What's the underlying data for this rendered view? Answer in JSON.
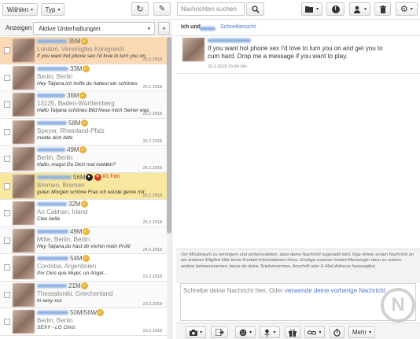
{
  "toolbar": {
    "select_label": "Wählen",
    "type_label": "Typ",
    "search_placeholder": "Nachrichten suchen"
  },
  "icons": {
    "refresh": "↻",
    "edit": "✎",
    "search": "🔍",
    "folder": "▰",
    "alert": "!",
    "user_action": "⚲",
    "trash": "🗑",
    "settings": "⚙",
    "caret": "▾"
  },
  "left": {
    "show_label": "Anzeigen",
    "filter_value": "Aktive Unterhaltungen"
  },
  "conversations": [
    {
      "age": "35M",
      "location": "London, Vereinigtes Königreich",
      "message": "If you want hot phone sex I'd love to turn you on",
      "date": "26.2.2018",
      "style": "orange"
    },
    {
      "age": "33M",
      "location": "Berlin, Berlin",
      "message": "Hey Tatjana,ich hoffe du hattest ein schönes",
      "date": "26.2.2018",
      "style": "normal"
    },
    {
      "age": "36M",
      "location": "13125, Baden-Württemberg",
      "message": "Hallo Tatjana schönes Bild freue mich Seiner was",
      "date": "26.2.2018",
      "style": "alt"
    },
    {
      "age": "58M",
      "location": "Speyer, Rheinland-Pfalz",
      "message": "melde dich bitte",
      "date": "26.2.2018",
      "style": "normal"
    },
    {
      "age": "49M",
      "location": "Berlin, Berlin",
      "message": "Hallo, magst Du Dich mal melden?",
      "date": "26.2.2018",
      "style": "alt"
    },
    {
      "age": "56M",
      "location": "Bremen, Bremen",
      "message": "guten Morgen schöne Frau ich würde gerne mit",
      "date": "26.2.2018",
      "style": "yellow",
      "fan": "#1 Fan"
    },
    {
      "age": "32M",
      "location": "An Cabhan, Irland",
      "message": "Ciao bella",
      "date": "25.2.2018",
      "style": "normal"
    },
    {
      "age": "49M",
      "location": "Mitte, Berlin, Berlin",
      "message": "Hey Tatjana,du hast dir vorhin mein Profil",
      "date": "24.2.2018",
      "style": "alt"
    },
    {
      "age": "54M",
      "location": "Cordoba, Argentinien",
      "message": "Por Dios que Mujer, un Angel...",
      "date": "23.2.2018",
      "style": "normal"
    },
    {
      "age": "21M",
      "location": "Thessaloniki, Griechenland",
      "message": "hi sexy xxx",
      "date": "23.2.2018",
      "style": "alt"
    },
    {
      "age": "50M/56W",
      "location": "Berlin, Berlin",
      "message": "SEXY - LG Chris",
      "date": "23.2.2018",
      "style": "normal"
    }
  ],
  "conversation": {
    "title_prefix": "Ich und",
    "quick_view": "Schnellansicht",
    "message": "If you want hot phone sex I'd love to turn you on and get you to cum hard. Drop me a message if you want to play.",
    "message_date": "26.2.2018 15:04 Uhr"
  },
  "notice": "Um Missbrauch zu verringern und sicherzustellen, dass deine Nachricht zugestellt wird, füge deiner ersten Nachricht an ein anderes Mitglied bitte keine Kontakt-Informationen hinzu. Erwäge unseren Instant-Messenger dazu zu nutzen, andere kennenzulernen, bevor du deine Telefonnummer, Anschrift oder E-Mail-Adresse herausgibst.",
  "compose": {
    "placeholder": "Schreibe deine Nachricht hier, Oder ",
    "link": "verwende deine vorherige Nachricht"
  },
  "compose_toolbar": {
    "more_label": "Mehr"
  },
  "watermark": "N"
}
